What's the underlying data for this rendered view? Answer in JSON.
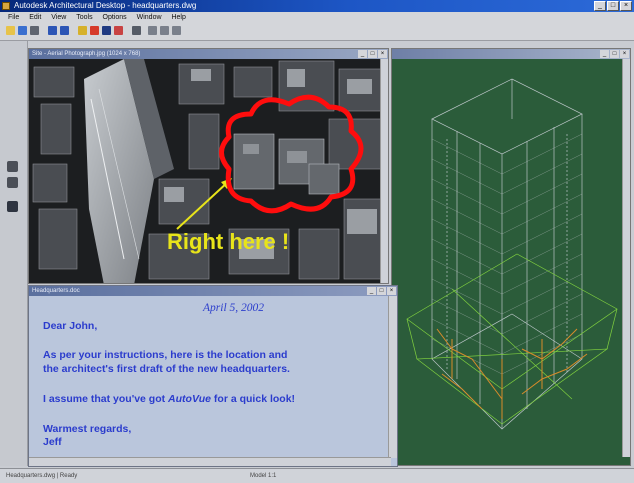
{
  "window": {
    "title": "Autodesk Architectural Desktop - headquarters.dwg"
  },
  "menu": {
    "items": [
      "File",
      "Edit",
      "View",
      "Tools",
      "Options",
      "Window",
      "Help"
    ]
  },
  "photo_window": {
    "title": "Site - Aerial Photograph.jpg  (1024 x 768)"
  },
  "annotation": {
    "text": "Right here !",
    "text_color": "#e8e41a",
    "cloud_color": "#ff0d0d"
  },
  "letter_window": {
    "title": "Headquarters.doc"
  },
  "letter": {
    "date": "April 5, 2002",
    "greeting": "Dear John,",
    "body_line1": "As per your instructions, here is the location and",
    "body_line2": "the architect's first draft of the new headquarters.",
    "assume_prefix": "I assume that you've got ",
    "assume_product": "AutoVue",
    "assume_suffix": " for a quick look!",
    "closing": "Warmest regards,",
    "signature": "Jeff",
    "text_color": "#2b3ccd"
  },
  "status": {
    "left": "Headquarters.dwg  |  Ready",
    "right": "Model   1:1"
  },
  "colors": {
    "model_background": "#2b5c3a",
    "wireframe_primary": "#c9d0d6",
    "wireframe_secondary": "#d88b2a",
    "wireframe_tertiary": "#7fcf3f"
  }
}
